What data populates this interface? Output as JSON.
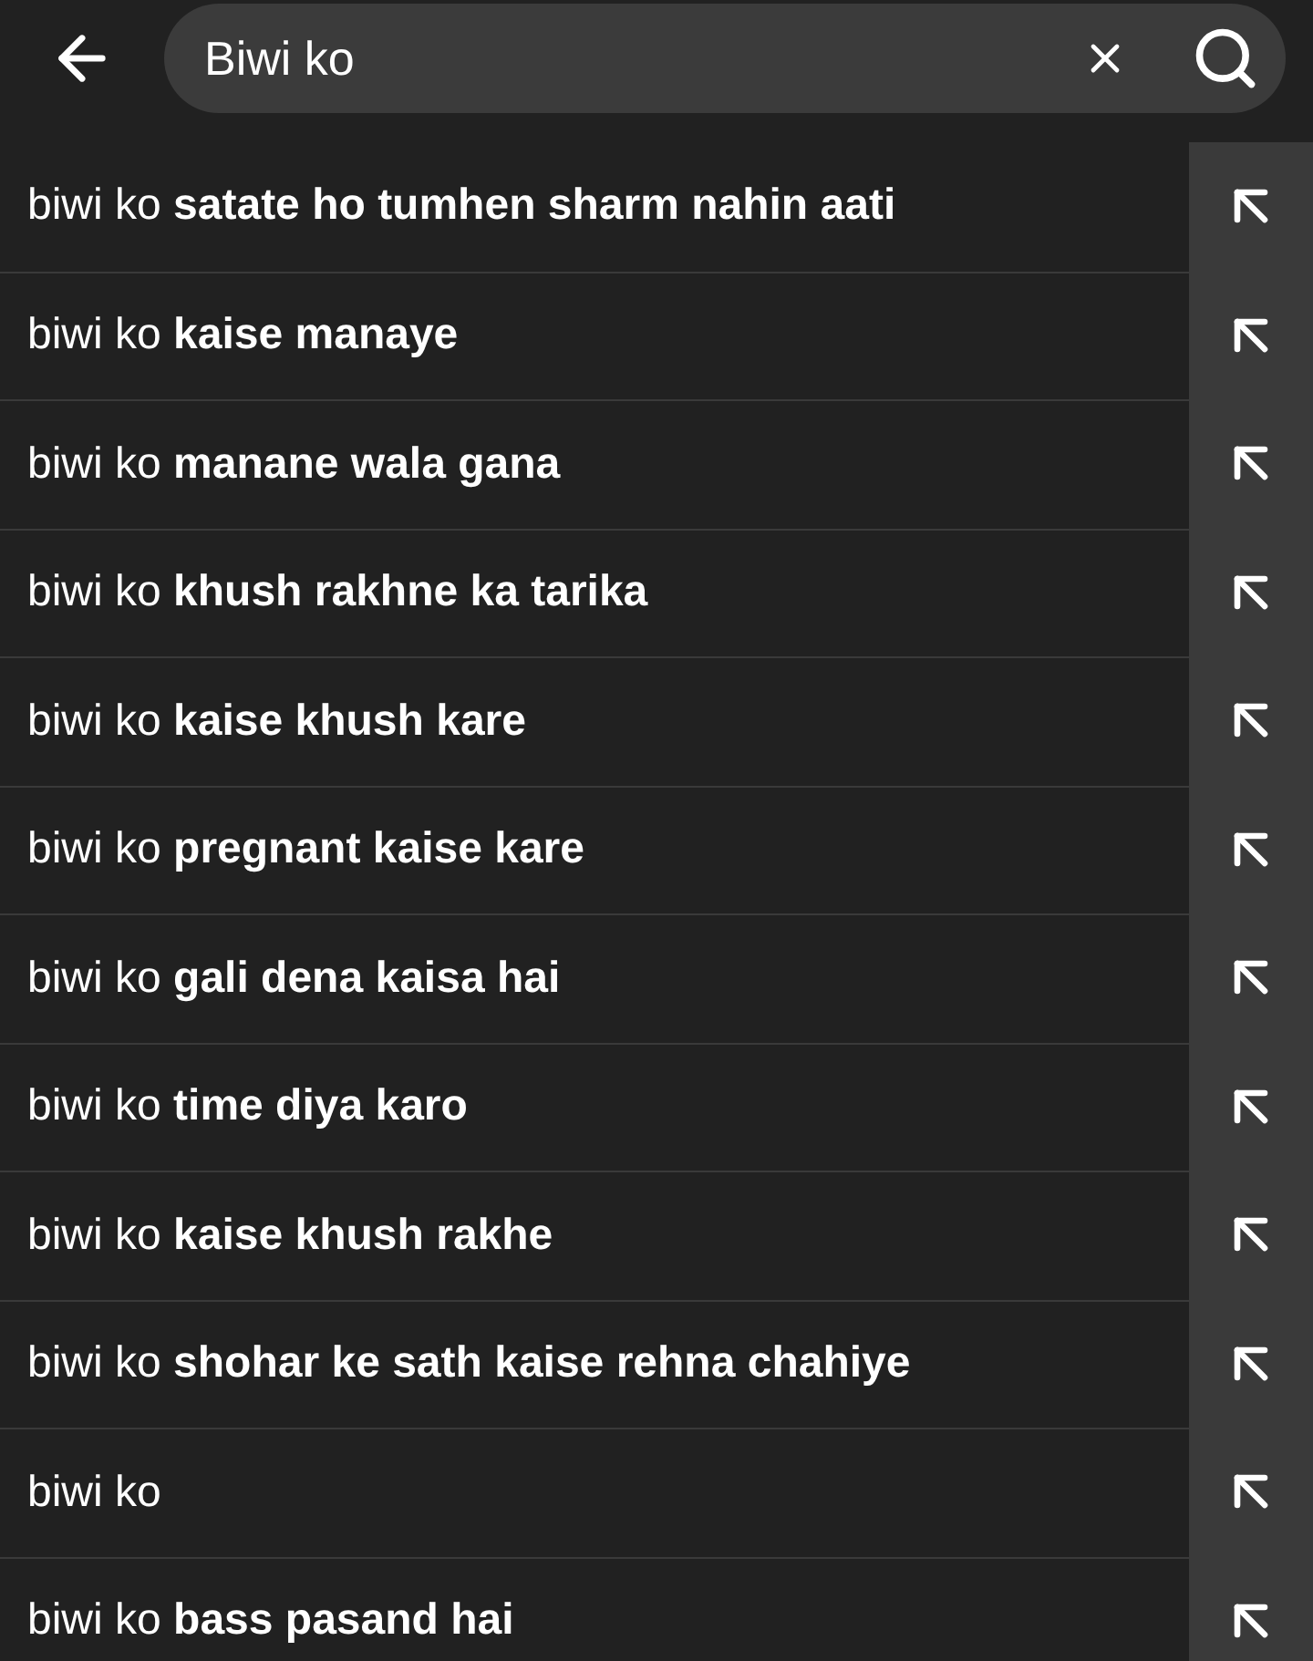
{
  "search": {
    "value": "Biwi ko"
  },
  "suggestions": [
    {
      "text": "biwi ko **satate ho tumhen sharm nahin aati**"
    },
    {
      "text": "biwi ko **kaise manaye**"
    },
    {
      "text": "biwi ko **manane wala gana**"
    },
    {
      "text": "biwi ko **khush rakhne ka tarika**"
    },
    {
      "text": "biwi ko **kaise khush kare**"
    },
    {
      "text": "biwi ko **pregnant kaise kare**"
    },
    {
      "text": "biwi ko **gali dena kaisa hai**"
    },
    {
      "text": "biwi ko **time diya karo**"
    },
    {
      "text": "biwi ko **kaise khush rakhe**"
    },
    {
      "text": "biwi ko **shohar ke sath kaise rehna chahiye**"
    },
    {
      "text": "biwi ko"
    },
    {
      "text": "biwi ko **bass pasand hai**"
    }
  ]
}
